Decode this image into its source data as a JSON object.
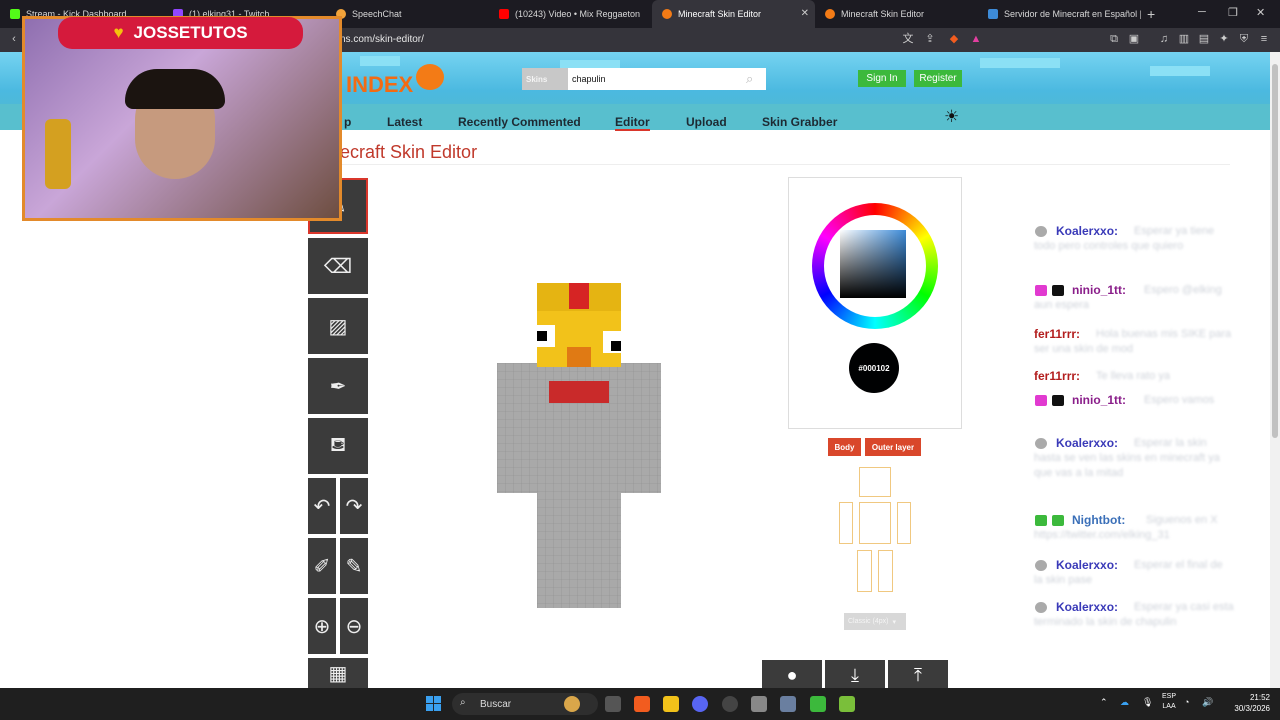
{
  "browser": {
    "tabs": [
      {
        "label": "Stream - Kick Dashboard",
        "color": "#53fc18"
      },
      {
        "label": "(1) elking31 - Twitch",
        "color": "#9146ff"
      },
      {
        "label": "SpeechChat",
        "color": "#f2a33a"
      },
      {
        "label": "(10243) Video • Mix Reggaeton",
        "color": "#ff0000"
      },
      {
        "label": "Minecraft Skin Editor",
        "color": "#f37b16"
      },
      {
        "label": "Minecraft Skin Editor",
        "color": "#f37b16"
      },
      {
        "label": "Servidor de Minecraft en Español | U",
        "color": "#3d8bd8"
      }
    ],
    "url": "ns.com/skin-editor/"
  },
  "header": {
    "logo_text": "INDEX",
    "search_category": "Skins",
    "search_value": "chapulin",
    "sign_in": "Sign In",
    "register": "Register",
    "nav": [
      {
        "label": "p"
      },
      {
        "label": "Latest"
      },
      {
        "label": "Recently Commented"
      },
      {
        "label": "Editor"
      },
      {
        "label": "Upload"
      },
      {
        "label": "Skin Grabber"
      }
    ]
  },
  "page": {
    "title": "ecraft Skin Editor"
  },
  "editor": {
    "selected_color": "#000102",
    "layer_buttons": [
      "Body",
      "Outer layer"
    ],
    "model_select": "Classic (4px)"
  },
  "chat": [
    {
      "user": "Koalerxxo:",
      "color": "#3a3ab8",
      "msg": "Esperar ya tiene todo pero controles que quiero"
    },
    {
      "user": "ninio_1tt:",
      "color": "#8a1e8a",
      "msg": "Espero @elking aun espera"
    },
    {
      "user": "fer11rrr:",
      "color": "#b31e1e",
      "msg": "Hola buenas mis SIKE para ser una skin de mod"
    },
    {
      "user": "fer11rrr:",
      "color": "#b31e1e",
      "msg": "Te lleva rato ya"
    },
    {
      "user": "ninio_1tt:",
      "color": "#8a1e8a",
      "msg": "Espero vamos"
    },
    {
      "user": "Koalerxxo:",
      "color": "#3a3ab8",
      "msg": "Esperar la skin hasta se ven las skins en minecraft ya que vas a la mitad"
    },
    {
      "user": "Nightbot:",
      "color": "#3a6fb8",
      "msg": "Siguenos en X https://twitter.com/elking_31"
    },
    {
      "user": "Koalerxxo:",
      "color": "#3a3ab8",
      "msg": "Esperar el final de la skin pase"
    },
    {
      "user": "Koalerxxo:",
      "color": "#3a3ab8",
      "msg": "Esperar ya casi esta terminado la skin de chapulin"
    }
  ],
  "webcam": {
    "name": "JOSSETUTOS"
  },
  "taskbar": {
    "search": "Buscar",
    "lang_top": "ESP",
    "lang_bottom": "LAA",
    "time": "21:52",
    "date": "30/3/2026"
  }
}
